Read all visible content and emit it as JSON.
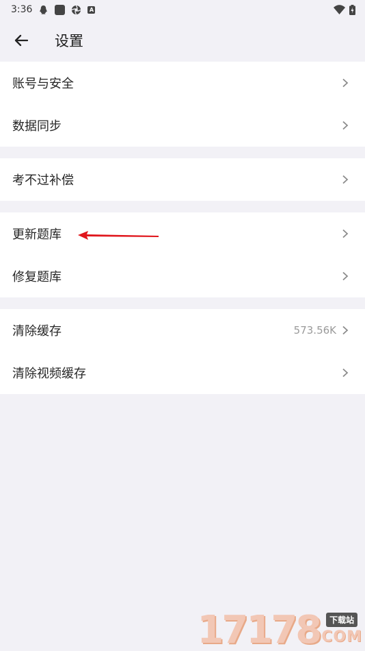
{
  "status_bar": {
    "time": "3:36",
    "icons": [
      "qq-icon",
      "square-app-icon",
      "aperture-icon",
      "a-badge-icon",
      "wifi-icon",
      "battery-icon"
    ],
    "a_badge_text": "A"
  },
  "app_bar": {
    "title": "设置",
    "back_icon": "arrow-left-icon"
  },
  "groups": [
    {
      "items": [
        {
          "label": "账号与安全"
        },
        {
          "label": "数据同步"
        }
      ]
    },
    {
      "items": [
        {
          "label": "考不过补偿"
        }
      ]
    },
    {
      "items": [
        {
          "label": "更新题库"
        },
        {
          "label": "修复题库"
        }
      ]
    },
    {
      "items": [
        {
          "label": "清除缓存",
          "value": "573.56K"
        },
        {
          "label": "清除视频缓存"
        }
      ]
    }
  ],
  "annotation": {
    "color": "#e0161c"
  },
  "watermark": {
    "number": "17178",
    "cn": "下载站",
    "com": "COM"
  },
  "colors": {
    "background": "#f2f1f6",
    "card": "#ffffff",
    "chevron": "#8a8a8a",
    "value_text": "#9a9a9a"
  }
}
